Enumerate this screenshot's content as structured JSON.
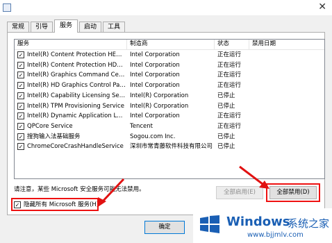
{
  "tabs": [
    "常规",
    "引导",
    "服务",
    "启动",
    "工具"
  ],
  "active_tab": "服务",
  "table": {
    "columns": [
      "服务",
      "制造商",
      "状态",
      "禁用日期"
    ],
    "rows": [
      {
        "service": "Intel(R) Content Protection HECI ...",
        "maker": "Intel Corporation",
        "status": "正在运行"
      },
      {
        "service": "Intel(R) Content Protection HDCP...",
        "maker": "Intel Corporation",
        "status": "正在运行"
      },
      {
        "service": "Intel(R) Graphics Command Cent...",
        "maker": "Intel Corporation",
        "status": "正在运行"
      },
      {
        "service": "Intel(R) HD Graphics Control Pan...",
        "maker": "Intel Corporation",
        "status": "正在运行"
      },
      {
        "service": "Intel(R) Capability Licensing Servi...",
        "maker": "Intel(R) Corporation",
        "status": "已停止"
      },
      {
        "service": "Intel(R) TPM Provisioning Service",
        "maker": "Intel(R) Corporation",
        "status": "已停止"
      },
      {
        "service": "Intel(R) Dynamic Application Loa...",
        "maker": "Intel Corporation",
        "status": "正在运行"
      },
      {
        "service": "QPCore Service",
        "maker": "Tencent",
        "status": "正在运行"
      },
      {
        "service": "搜狗输入法基础服务",
        "maker": "Sogou.com Inc.",
        "status": "已停止"
      },
      {
        "service": "ChromeCoreCrashHandleService",
        "maker": "深圳市常青藤软件科技有限公司",
        "status": "已停止"
      }
    ]
  },
  "note": "请注意，某些 Microsoft 安全服务可能无法禁用。",
  "buttons": {
    "enable_all": "全部启用(E)",
    "disable_all": "全部禁用(D)",
    "ok": "确定"
  },
  "hide_ms_label": "隐藏所有 Microsoft 服务(H)",
  "watermark": {
    "title": "Windows",
    "cn": "系统之家",
    "url": "www.bjjmlv.com"
  },
  "colors": {
    "annotation_red": "#e11111",
    "watermark_blue": "#1a5fb4",
    "primary_border": "#0078d7"
  },
  "icons": [
    "checkmark-icon",
    "close-icon",
    "windows-logo-icon",
    "red-arrow-icon"
  ]
}
